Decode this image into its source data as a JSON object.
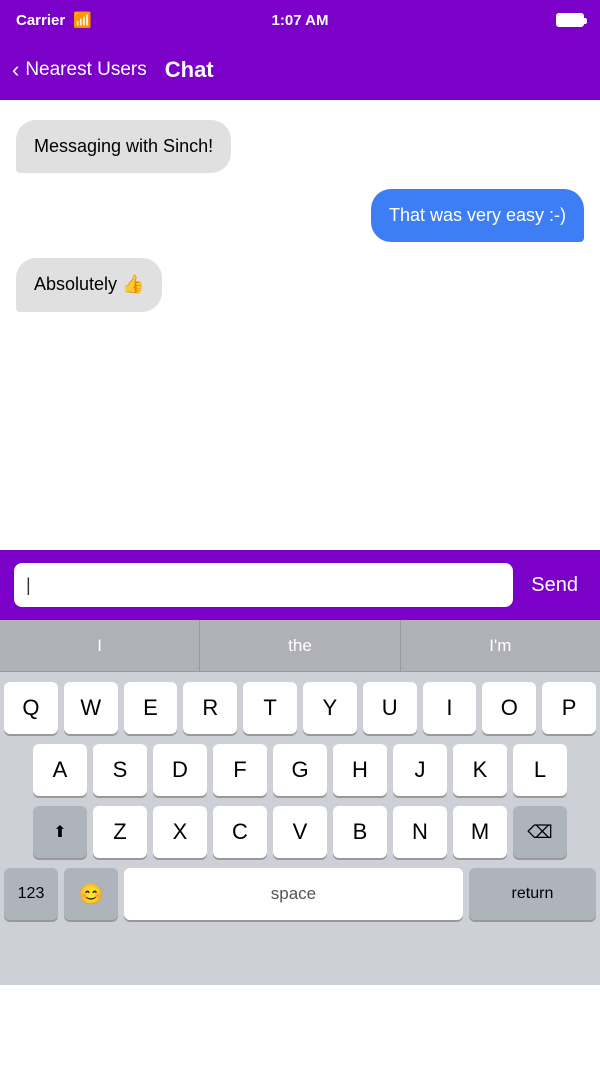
{
  "statusBar": {
    "carrier": "Carrier",
    "wifi": "wifi",
    "time": "1:07 AM",
    "battery": "full"
  },
  "navBar": {
    "backLabel": "Nearest Users",
    "title": "Chat"
  },
  "messages": [
    {
      "id": 1,
      "side": "left",
      "text": "Messaging with Sinch!"
    },
    {
      "id": 2,
      "side": "right",
      "text": "That was very easy :-)"
    },
    {
      "id": 3,
      "side": "left",
      "text": "Absolutely 👍"
    }
  ],
  "inputBar": {
    "placeholder": "",
    "sendLabel": "Send"
  },
  "predictive": {
    "items": [
      "I",
      "the",
      "I'm"
    ]
  },
  "keyboard": {
    "rows": [
      [
        "Q",
        "W",
        "E",
        "R",
        "T",
        "Y",
        "U",
        "I",
        "O",
        "P"
      ],
      [
        "A",
        "S",
        "D",
        "F",
        "G",
        "H",
        "J",
        "K",
        "L"
      ],
      [
        "Z",
        "X",
        "C",
        "V",
        "B",
        "N",
        "M"
      ]
    ],
    "bottomRow": [
      "123",
      "😊",
      "space",
      "return"
    ]
  }
}
